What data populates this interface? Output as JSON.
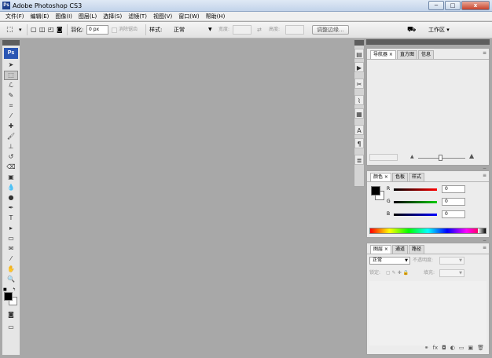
{
  "window": {
    "title": "Adobe Photoshop CS3",
    "app_icon": "Ps",
    "minimize": "─",
    "maximize": "□",
    "close": "x"
  },
  "menu": [
    "文件(F)",
    "编辑(E)",
    "图像(I)",
    "图层(L)",
    "选择(S)",
    "滤镜(T)",
    "视图(V)",
    "窗口(W)",
    "帮助(H)"
  ],
  "options": {
    "feather_label": "羽化:",
    "feather_value": "0 px",
    "antialias_label": "消除锯齿",
    "style_label": "样式:",
    "style_value": "正常",
    "width_label": "宽度:",
    "height_label": "高度:",
    "refine_edge_button": "调整边缘...",
    "workspace_label": "工作区 ▾"
  },
  "toolbar": {
    "logo": "Ps",
    "tools": [
      {
        "name": "move-tool-icon",
        "glyph": "➤"
      },
      {
        "name": "marquee-tool-icon",
        "glyph": "⬚"
      },
      {
        "name": "lasso-tool-icon",
        "glyph": "ℒ"
      },
      {
        "name": "quick-select-tool-icon",
        "glyph": "✎"
      },
      {
        "name": "crop-tool-icon",
        "glyph": "⌗"
      },
      {
        "name": "slice-tool-icon",
        "glyph": "⁄"
      },
      {
        "name": "healing-brush-tool-icon",
        "glyph": "✚"
      },
      {
        "name": "brush-tool-icon",
        "glyph": "🖌"
      },
      {
        "name": "clone-stamp-tool-icon",
        "glyph": "⊥"
      },
      {
        "name": "history-brush-tool-icon",
        "glyph": "↺"
      },
      {
        "name": "eraser-tool-icon",
        "glyph": "⌫"
      },
      {
        "name": "gradient-tool-icon",
        "glyph": "▣"
      },
      {
        "name": "blur-tool-icon",
        "glyph": "💧"
      },
      {
        "name": "dodge-tool-icon",
        "glyph": "●"
      },
      {
        "name": "pen-tool-icon",
        "glyph": "✒"
      },
      {
        "name": "type-tool-icon",
        "glyph": "T"
      },
      {
        "name": "path-select-tool-icon",
        "glyph": "▸"
      },
      {
        "name": "shape-tool-icon",
        "glyph": "▭"
      },
      {
        "name": "notes-tool-icon",
        "glyph": "✉"
      },
      {
        "name": "eyedropper-tool-icon",
        "glyph": "⁄"
      },
      {
        "name": "hand-tool-icon",
        "glyph": "✋"
      },
      {
        "name": "zoom-tool-icon",
        "glyph": "🔍"
      }
    ],
    "quick_mask": "◙",
    "screen_mode": "▭"
  },
  "dock": {
    "icons": [
      {
        "name": "navigator-dock-icon",
        "glyph": "▤"
      },
      {
        "name": "histogram-dock-icon",
        "glyph": "▶"
      },
      {
        "name": "tools-preset-dock-icon",
        "glyph": "✂"
      },
      {
        "name": "brushes-dock-icon",
        "glyph": "⌇"
      },
      {
        "name": "layer-comps-dock-icon",
        "glyph": "▦"
      },
      {
        "name": "character-dock-icon",
        "glyph": "A"
      },
      {
        "name": "paragraph-dock-icon",
        "glyph": "¶"
      },
      {
        "name": "actions-dock-icon",
        "glyph": "≣"
      }
    ]
  },
  "navigator_panel": {
    "tabs": [
      "导航器 ×",
      "直方图",
      "信息"
    ],
    "active_tab": 0
  },
  "color_panel": {
    "tabs": [
      "颜色 ×",
      "色板",
      "样式"
    ],
    "active_tab": 0,
    "channels": [
      {
        "label": "R",
        "value": "0",
        "color": "#ff0000"
      },
      {
        "label": "G",
        "value": "0",
        "color": "#00c000"
      },
      {
        "label": "B",
        "value": "0",
        "color": "#0000ff"
      }
    ]
  },
  "layers_panel": {
    "tabs": [
      "图层 ×",
      "通道",
      "路径"
    ],
    "active_tab": 0,
    "blend_mode": "正常",
    "opacity_label": "不透明度:",
    "lock_label": "锁定:",
    "fill_label": "填充:"
  }
}
